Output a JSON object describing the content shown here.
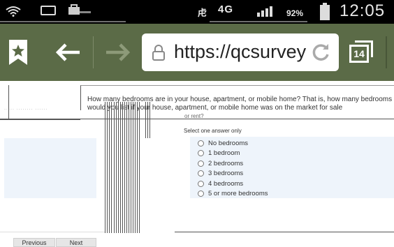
{
  "status_bar": {
    "network": "4G",
    "battery": "92%",
    "time": "12:05 PM",
    "icons": [
      "wifi-icon",
      "email-icon",
      "shopping-bag-icon",
      "vibrate-icon",
      "signal-icon",
      "battery-icon"
    ]
  },
  "browser": {
    "url": "https://qcsurveys",
    "tab_count": "14",
    "toolbar_color": "#5b6b47",
    "icons": [
      "bookmark-star-icon",
      "back-arrow-icon",
      "forward-arrow-icon",
      "lock-icon",
      "reload-icon",
      "tabs-icon"
    ]
  },
  "survey": {
    "question": "How many bedrooms are in your house, apartment, or mobile home? That is, how many bedrooms would you list if your house, apartment, or mobile home was on the market for sale",
    "question_tail": "or rent?",
    "instruction": "Select one answer only",
    "options": [
      "No bedrooms",
      "1 bedroom",
      "2 bedrooms",
      "3 bedrooms",
      "4 bedrooms",
      "5 or more bedrooms"
    ],
    "previous_label": "Previous",
    "next_label": "Next",
    "panel_color": "#eef4fb"
  }
}
